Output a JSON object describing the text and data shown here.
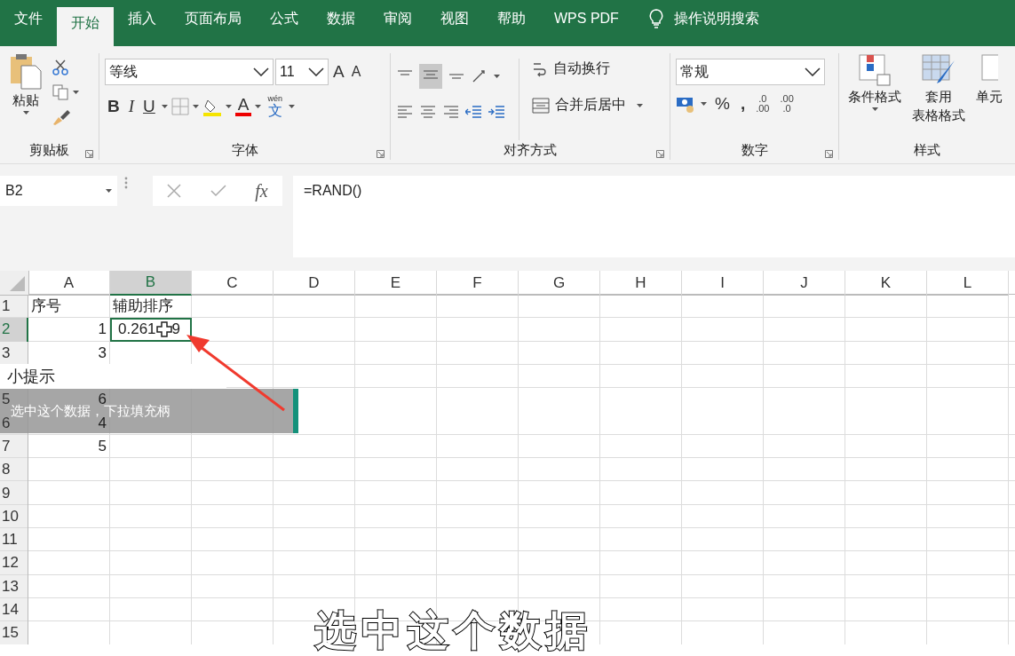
{
  "tabs": [
    {
      "label": "文件",
      "selected": false
    },
    {
      "label": "开始",
      "selected": true
    },
    {
      "label": "插入",
      "selected": false
    },
    {
      "label": "页面布局",
      "selected": false
    },
    {
      "label": "公式",
      "selected": false
    },
    {
      "label": "数据",
      "selected": false
    },
    {
      "label": "审阅",
      "selected": false
    },
    {
      "label": "视图",
      "selected": false
    },
    {
      "label": "帮助",
      "selected": false
    },
    {
      "label": "WPS PDF",
      "selected": false
    }
  ],
  "tell_me": "操作说明搜索",
  "ribbon": {
    "clipboard": {
      "paste": "粘贴",
      "label": "剪贴板"
    },
    "font": {
      "face": "等线",
      "size": "11",
      "grow": "A",
      "shrink": "A",
      "bold": "B",
      "italic": "I",
      "underline": "U",
      "font_color": "A",
      "phonetic_top": "wén",
      "phonetic": "文",
      "label": "字体"
    },
    "alignment": {
      "wrap": "自动换行",
      "merge": "合并后居中",
      "label": "对齐方式"
    },
    "number": {
      "format": "常规",
      "percent": "%",
      "comma": ",",
      "dec_increase": [
        ".0",
        ".00"
      ],
      "dec_decrease": [
        ".00",
        ".0"
      ],
      "label": "数字"
    },
    "styles": {
      "conditional": "条件格式",
      "table_top": "套用",
      "table_bottom": "表格格式",
      "cell_styles": "单元",
      "label": "样式"
    }
  },
  "formula_bar": {
    "name_box": "B2",
    "function_label": "fx",
    "formula": "=RAND()"
  },
  "sheet": {
    "columns": [
      {
        "label": "A",
        "selected": false
      },
      {
        "label": "B",
        "selected": true
      },
      {
        "label": "C",
        "selected": false
      },
      {
        "label": "D",
        "selected": false
      },
      {
        "label": "E",
        "selected": false
      },
      {
        "label": "F",
        "selected": false
      },
      {
        "label": "G",
        "selected": false
      },
      {
        "label": "H",
        "selected": false
      },
      {
        "label": "I",
        "selected": false
      },
      {
        "label": "J",
        "selected": false
      },
      {
        "label": "K",
        "selected": false
      },
      {
        "label": "L",
        "selected": false
      }
    ],
    "rows": [
      {
        "number": "1",
        "selected": false,
        "cells": [
          {
            "value": "序号",
            "kind": "text",
            "selected": false
          },
          {
            "value": "辅助排序",
            "kind": "text",
            "selected": false
          }
        ]
      },
      {
        "number": "2",
        "selected": true,
        "cells": [
          {
            "value": "1",
            "kind": "number",
            "selected": false
          },
          {
            "value": "0.261",
            "tail": "9",
            "kind": "number",
            "selected": true
          }
        ]
      },
      {
        "number": "3",
        "selected": false,
        "cells": [
          {
            "value": "3",
            "kind": "number",
            "selected": false
          }
        ]
      },
      {
        "cells": []
      },
      {
        "number": "5",
        "selected": false,
        "cells": [
          {
            "value": "6",
            "kind": "number",
            "selected": false
          }
        ]
      },
      {
        "number": "6",
        "selected": false,
        "cells": [
          {
            "value": "4",
            "kind": "number",
            "selected": false
          }
        ]
      },
      {
        "number": "7",
        "selected": false,
        "cells": [
          {
            "value": "5",
            "kind": "number",
            "selected": false
          }
        ]
      },
      {
        "number": "8",
        "selected": false,
        "cells": []
      },
      {
        "number": "9",
        "selected": false,
        "cells": []
      },
      {
        "number": "10",
        "selected": false,
        "cells": []
      },
      {
        "number": "11",
        "selected": false,
        "cells": []
      },
      {
        "number": "12",
        "selected": false,
        "cells": []
      },
      {
        "number": "13",
        "selected": false,
        "cells": []
      },
      {
        "number": "14",
        "selected": false,
        "cells": []
      },
      {
        "number": "15",
        "selected": false,
        "cells": []
      }
    ]
  },
  "tooltip": {
    "title": "小提示",
    "text": "选中这个数据，下拉填充柄"
  },
  "subtitle": "选中这个数据"
}
